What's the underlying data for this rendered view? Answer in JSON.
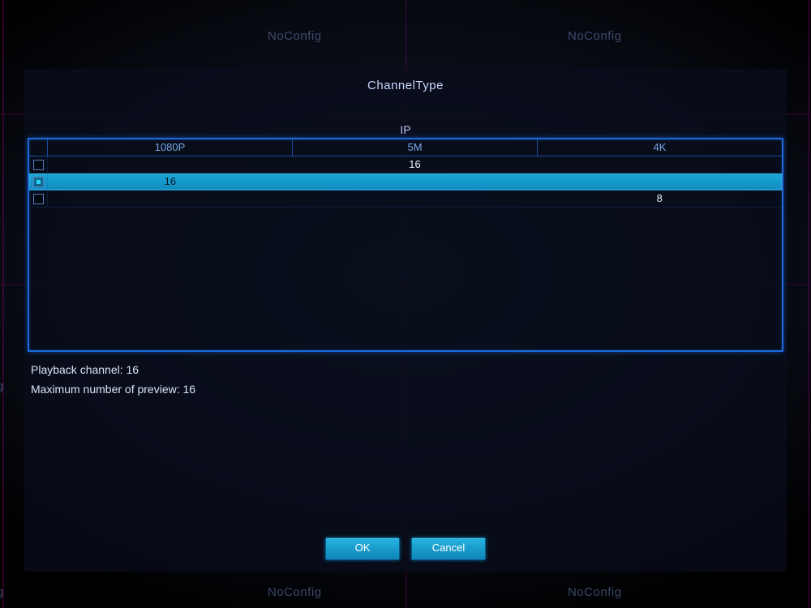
{
  "background": {
    "labels": [
      "NoConfig",
      "NoConfig",
      "NoConfig",
      "NoConfig"
    ],
    "labelSuffix": "g"
  },
  "dialog": {
    "title": "ChannelType",
    "group_label": "IP",
    "table": {
      "headers": [
        "1080P",
        "5M",
        "4K"
      ],
      "rows": [
        {
          "checked": false,
          "selected": false,
          "cells": [
            "",
            "16",
            ""
          ]
        },
        {
          "checked": true,
          "selected": true,
          "cells": [
            "16",
            "",
            ""
          ]
        },
        {
          "checked": false,
          "selected": false,
          "cells": [
            "",
            "",
            "8"
          ]
        }
      ]
    },
    "info": {
      "playback_label": "Playback channel: 16",
      "preview_label": "Maximum number of preview: 16"
    },
    "buttons": {
      "ok": "OK",
      "cancel": "Cancel"
    }
  }
}
